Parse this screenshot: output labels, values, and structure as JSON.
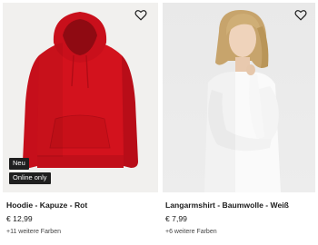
{
  "products": [
    {
      "title": "Hoodie - Kapuze - Rot",
      "price": "€ 12,99",
      "colors": "+11 weitere Farben",
      "badges": [
        "Neu",
        "Online only"
      ],
      "image_color": "#d3121d"
    },
    {
      "title": "Langarmshirt - Baumwolle - Weiß",
      "price": "€ 7,99",
      "colors": "+6 weitere Farben",
      "badges": [],
      "image_color": "#ffffff"
    }
  ],
  "icons": {
    "wishlist": "heart-outline-icon"
  }
}
